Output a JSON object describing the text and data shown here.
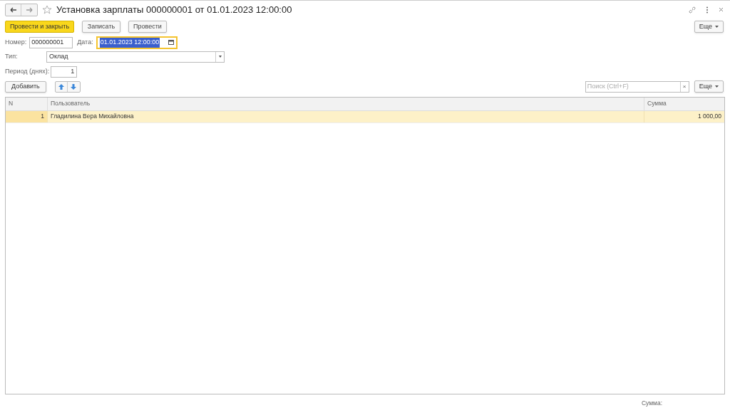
{
  "window": {
    "title": "Установка зарплаты 000000001 от 01.01.2023 12:00:00",
    "favorite": false
  },
  "command_bar": {
    "buttons": [
      {
        "label": "Провести и закрыть",
        "kind": "primary"
      },
      {
        "label": "Записать",
        "kind": "normal"
      },
      {
        "label": "Провести",
        "kind": "normal"
      }
    ],
    "more": "Еще"
  },
  "fields": {
    "number": {
      "label": "Номер:",
      "value": "000000001"
    },
    "date": {
      "label": "Дата:",
      "value": "01.01.2023 12:00:00",
      "focused": true
    },
    "type": {
      "label": "Тип:",
      "value": "Оклад"
    },
    "period": {
      "label": "Период (днях):",
      "value": "1"
    }
  },
  "table_toolbar": {
    "add": "Добавить",
    "search": {
      "placeholder": "Поиск (Ctrl+F)"
    },
    "clear": "×",
    "more": "Еще"
  },
  "table": {
    "columns": [
      "N",
      "Пользователь",
      "Сумма"
    ],
    "rows": [
      {
        "cells": [
          "1",
          "Гладилина Вера Михайловна",
          "1 000,00"
        ],
        "selected": true
      }
    ]
  },
  "footer": {
    "label": "Сумма:"
  }
}
